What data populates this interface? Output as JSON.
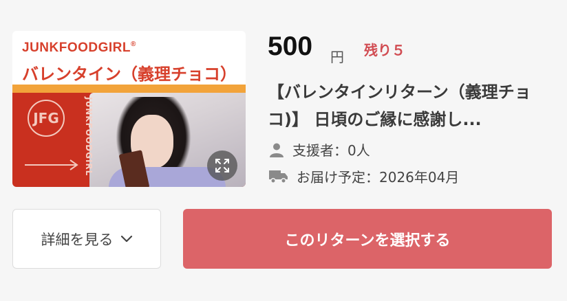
{
  "thumbnail": {
    "brand": "JUNKFOODGIRL",
    "registered_mark": "®",
    "subtitle": "バレンタイン（義理チョコ）",
    "vertical_brand": "JUNKFOODGIRL",
    "emblem_text": "JFG",
    "zoom_icon": "expand-icon"
  },
  "price": {
    "amount": "500",
    "unit": "円"
  },
  "stock": {
    "label": "残り５"
  },
  "title": "【バレンタインリターン（義理チョコ)】 日頃のご縁に感謝し...",
  "meta": {
    "supporters": "支援者：0人",
    "delivery": "お届け予定：2026年04月"
  },
  "buttons": {
    "details": "詳細を見る",
    "select": "このリターンを選択する"
  },
  "colors": {
    "accent": "#dc6468",
    "stock_text": "#d14c52",
    "brand_red": "#d7402c"
  }
}
